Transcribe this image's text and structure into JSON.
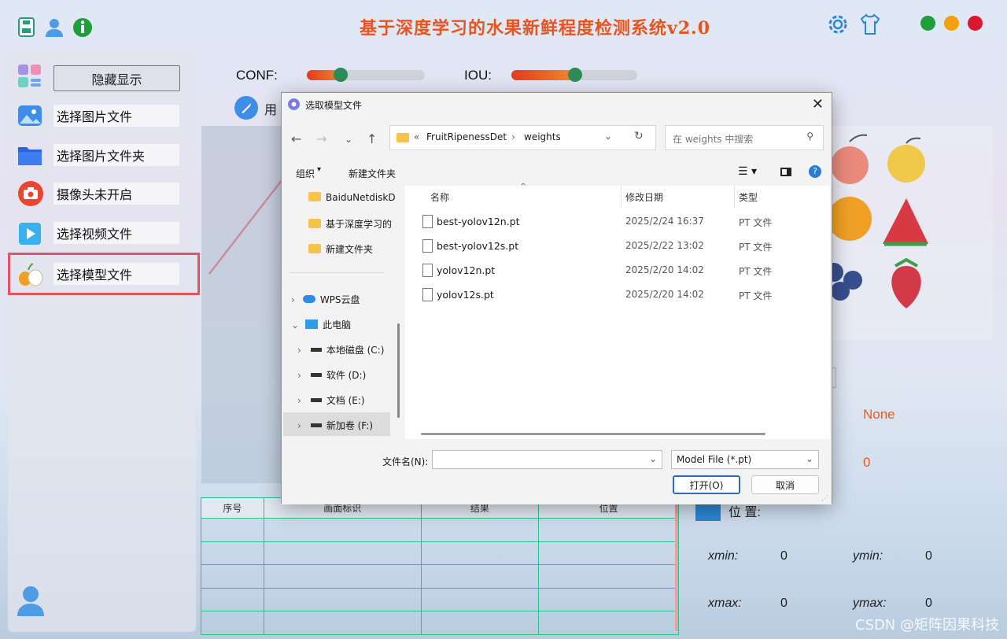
{
  "app": {
    "title": "基于深度学习的水果新鲜程度检测系统v2.0"
  },
  "sidebar": {
    "hide_button": "隐藏显示",
    "items": [
      {
        "label": "选择图片文件"
      },
      {
        "label": "选择图片文件夹"
      },
      {
        "label": "摄像头未开启"
      },
      {
        "label": "选择视频文件"
      },
      {
        "label": "选择模型文件"
      }
    ]
  },
  "controls": {
    "conf_label": "CONF:",
    "conf_value": 0.25,
    "iou_label": "IOU:",
    "iou_value": 0.5,
    "model_prefix": "用"
  },
  "table": {
    "headers": [
      "序号",
      "画面标识",
      "结果",
      "位置"
    ],
    "rows": [
      [
        "",
        "",
        "",
        ""
      ],
      [
        "",
        "",
        "",
        ""
      ],
      [
        "",
        "",
        "",
        ""
      ],
      [
        "",
        "",
        "",
        ""
      ],
      [
        "",
        "",
        "",
        ""
      ]
    ]
  },
  "info": {
    "result_value": "None",
    "count_value": "0",
    "position_label": "位 置:",
    "xmin_label": "xmin:",
    "xmin_value": "0",
    "ymin_label": "ymin:",
    "ymin_value": "0",
    "xmax_label": "xmax:",
    "xmax_value": "0",
    "ymax_label": "ymax:",
    "ymax_value": "0"
  },
  "dialog": {
    "title": "选取模型文件",
    "path_prefix": "«",
    "path_1": "FruitRipenessDet",
    "path_2": "weights",
    "search_placeholder": "在 weights 中搜索",
    "organize": "组织",
    "new_folder": "新建文件夹",
    "columns": {
      "name": "名称",
      "date": "修改日期",
      "type": "类型"
    },
    "files": [
      {
        "name": "best-yolov12n.pt",
        "date": "2025/2/24 16:37",
        "type": "PT 文件"
      },
      {
        "name": "best-yolov12s.pt",
        "date": "2025/2/22 13:02",
        "type": "PT 文件"
      },
      {
        "name": "yolov12n.pt",
        "date": "2025/2/20 14:02",
        "type": "PT 文件"
      },
      {
        "name": "yolov12s.pt",
        "date": "2025/2/20 14:02",
        "type": "PT 文件"
      }
    ],
    "nav_folders": [
      "BaiduNetdiskD",
      "基于深度学习的",
      "新建文件夹"
    ],
    "nav_wps": "WPS云盘",
    "nav_pc": "此电脑",
    "drives": [
      "本地磁盘 (C:)",
      "软件 (D:)",
      "文档 (E:)",
      "新加卷 (F:)"
    ],
    "filename_label": "文件名(N):",
    "filename_value": "",
    "filter_value": "Model File (*.pt)",
    "open_button": "打开(O)",
    "cancel_button": "取消"
  },
  "watermark": "CSDN @矩阵因果科技",
  "colors": {
    "title": "#e8541f",
    "highlight": "#e3545e",
    "table_border": "#2bc08e",
    "slider_knob": "#2f8b57",
    "win_green": "#1f9e3c",
    "win_orange": "#f2a10c",
    "win_red": "#d9182d"
  }
}
